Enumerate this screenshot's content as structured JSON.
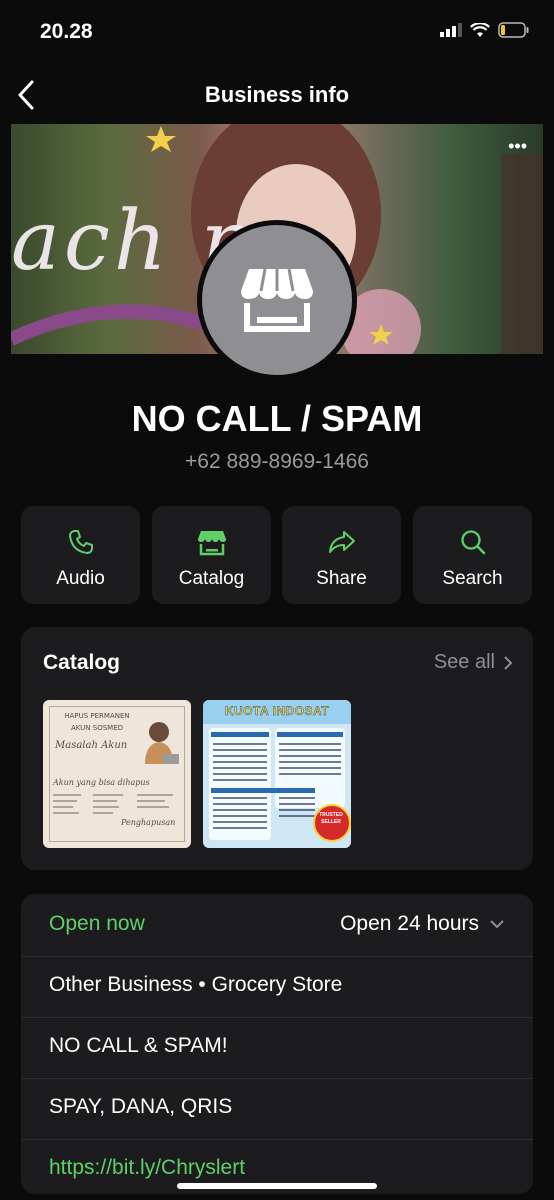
{
  "status_bar": {
    "time": "20.28"
  },
  "nav": {
    "title": "Business info"
  },
  "cover": {
    "text": "ach  ne"
  },
  "profile": {
    "name": "NO CALL / SPAM",
    "phone": "+62 889-8969-1466"
  },
  "actions": [
    {
      "label": "Audio",
      "icon": "phone-icon"
    },
    {
      "label": "Catalog",
      "icon": "storefront-icon"
    },
    {
      "label": "Share",
      "icon": "share-arrow-icon"
    },
    {
      "label": "Search",
      "icon": "search-icon"
    }
  ],
  "catalog": {
    "title": "Catalog",
    "see_all": "See all",
    "items": [
      {
        "title": "HAPUS PERMANEN AKUN SOSMED",
        "subtitle": "Masalah Akun",
        "sub2": "Akun yang bisa dihapus",
        "sub3": "Penghapusan"
      },
      {
        "title": "KUOTA INDOSAT",
        "badge": "TRUSTED SELLER"
      }
    ]
  },
  "info": {
    "open_now": "Open now",
    "hours": "Open 24 hours",
    "category": "Other Business • Grocery Store",
    "description": "NO CALL & SPAM!",
    "payment": "SPAY, DANA, QRIS",
    "link": "https://bit.ly/Chryslert"
  },
  "colors": {
    "accent": "#5fd068",
    "card": "#1c1c1e",
    "background": "#0b0b0b"
  }
}
